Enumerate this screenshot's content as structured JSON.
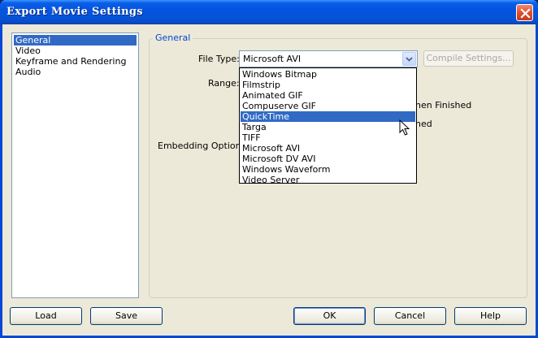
{
  "window": {
    "title": "Export Movie Settings"
  },
  "sidebar": {
    "items": [
      {
        "label": "General",
        "selected": true
      },
      {
        "label": "Video",
        "selected": false
      },
      {
        "label": "Keyframe and Rendering",
        "selected": false
      },
      {
        "label": "Audio",
        "selected": false
      }
    ]
  },
  "general": {
    "group_label": "General",
    "file_type_label": "File Type:",
    "file_type_value": "Microsoft AVI",
    "compile_settings_label": "Compile Settings...",
    "range_label": "Range:",
    "embedding_label": "Embedding Options:",
    "partial_text_1": "nen Finished",
    "partial_text_2": "ned"
  },
  "dropdown": {
    "options": [
      "Windows Bitmap",
      "Filmstrip",
      "Animated GIF",
      "Compuserve GIF",
      "QuickTime",
      "Targa",
      "TIFF",
      "Microsoft AVI",
      "Microsoft DV AVI",
      "Windows Waveform",
      "Video Server"
    ],
    "highlighted": "QuickTime"
  },
  "buttons": {
    "load": "Load",
    "save": "Save",
    "ok": "OK",
    "cancel": "Cancel",
    "help": "Help"
  },
  "icons": {
    "close": "close-icon",
    "dropdown_arrow": "chevron-down-icon",
    "cursor": "mouse-pointer-icon"
  },
  "colors": {
    "titlebar": "#0553e0",
    "selection": "#316ac5",
    "group_label": "#0046d5",
    "dialog_bg": "#ece9d8"
  }
}
